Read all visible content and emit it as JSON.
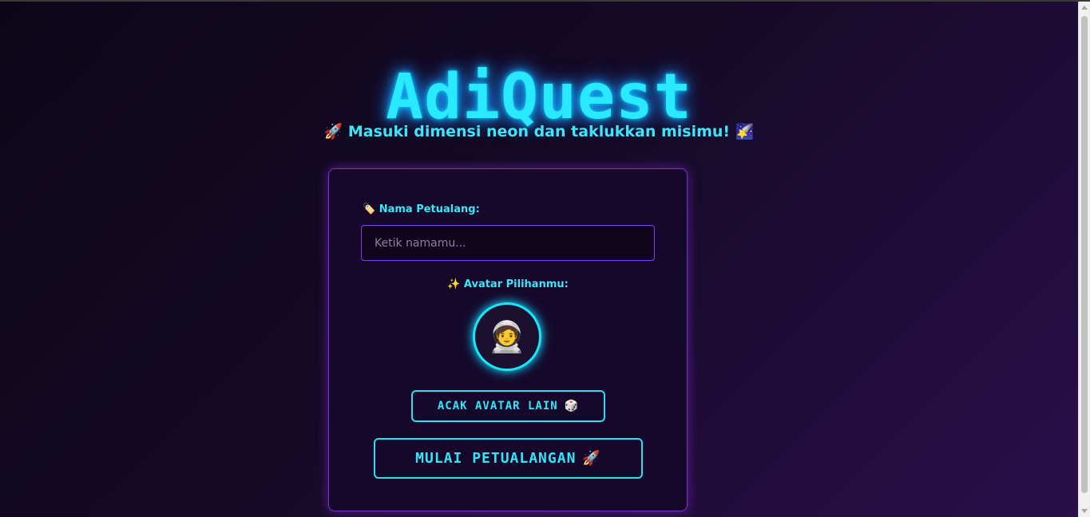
{
  "app": {
    "title": "AdiQuest",
    "subtitle": "Masuki dimensi neon dan taklukkan misimu!",
    "subtitle_icon_left": "🚀",
    "subtitle_icon_right": "🌠"
  },
  "form": {
    "name_label_icon": "🏷️",
    "name_label": "Nama Petualang:",
    "name_value": "",
    "name_placeholder": "Ketik namamu...",
    "avatar_label_icon": "✨",
    "avatar_label": "Avatar Pilihanmu:",
    "avatar_emoji": "🧑‍🚀",
    "random_button_label": "ACAK AVATAR LAIN",
    "random_button_icon": "🎲",
    "start_button_label": "MULAI PETUALANGAN",
    "start_button_icon": "🚀"
  },
  "colors": {
    "neon_cyan": "#29e9ff",
    "neon_purple": "#8d35e8",
    "background_dark": "#0d0618",
    "background_purple": "#2a0f4a"
  },
  "icons": {
    "subtitle_left": "rocket-icon",
    "subtitle_right": "shooting-star-icon",
    "name_label": "tag-icon",
    "avatar_label": "sparkles-icon",
    "avatar": "astronaut-icon",
    "random_button": "dice-icon",
    "start_button": "rocket-icon"
  }
}
